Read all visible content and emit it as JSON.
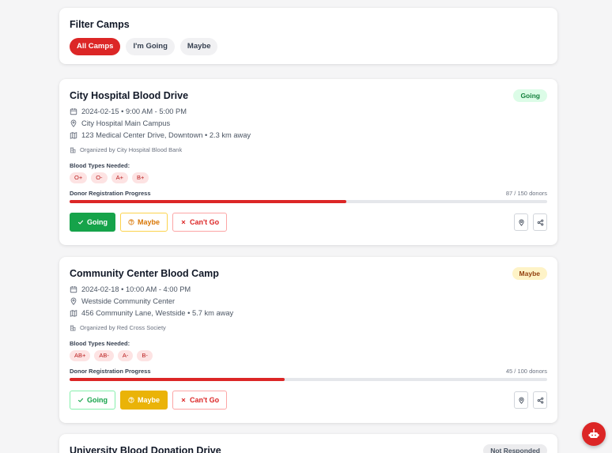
{
  "filter": {
    "title": "Filter Camps",
    "options": [
      "All Camps",
      "I'm Going",
      "Maybe"
    ],
    "active": "All Camps"
  },
  "labels": {
    "blood_types_needed": "Blood Types Needed:",
    "donor_progress": "Donor Registration Progress",
    "going": "Going",
    "maybe": "Maybe",
    "cant_go": "Can't Go"
  },
  "camps": [
    {
      "title": "City Hospital Blood Drive",
      "status": "Going",
      "datetime": "2024-02-15 • 9:00 AM - 5:00 PM",
      "venue": "City Hospital Main Campus",
      "address": "123 Medical Center Drive, Downtown • 2.3 km away",
      "organizer": "Organized by City Hospital Blood Bank",
      "blood_types": [
        "O+",
        "O-",
        "A+",
        "B+"
      ],
      "donors_text": "87 / 150 donors",
      "progress": 0.58,
      "response": "going"
    },
    {
      "title": "Community Center Blood Camp",
      "status": "Maybe",
      "datetime": "2024-02-18 • 10:00 AM - 4:00 PM",
      "venue": "Westside Community Center",
      "address": "456 Community Lane, Westside • 5.7 km away",
      "organizer": "Organized by Red Cross Society",
      "blood_types": [
        "AB+",
        "AB-",
        "A-",
        "B-"
      ],
      "donors_text": "45 / 100 donors",
      "progress": 0.45,
      "response": "maybe"
    },
    {
      "title": "University Blood Donation Drive",
      "status": "Not Responded"
    }
  ],
  "colors": {
    "accent": "#dc2626",
    "going": "#16a34a",
    "maybe": "#eab308"
  },
  "icons": {
    "date": "calendar-icon",
    "venue": "location-pin-icon",
    "address": "map-icon",
    "organizer": "building-icon",
    "fab": "chatbot-icon"
  }
}
